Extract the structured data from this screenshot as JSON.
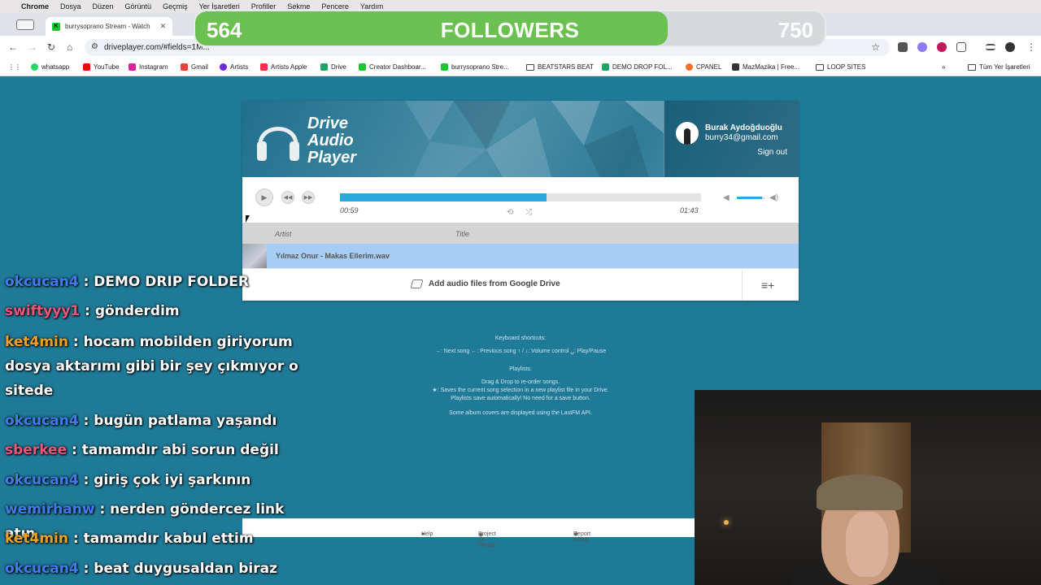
{
  "menubar": {
    "app": "Chrome",
    "items": [
      "Dosya",
      "Düzen",
      "Görüntü",
      "Geçmiş",
      "Yer İşaretleri",
      "Profiller",
      "Sekme",
      "Pencere",
      "Yardım"
    ]
  },
  "tabs": {
    "active_title": "burrysoprano Stream - Watch",
    "partial_title": "le"
  },
  "toolbar": {
    "url": "driveplayer.com/#fields=1M..."
  },
  "bookmarks": [
    {
      "label": "whatsapp",
      "color": "#25d366"
    },
    {
      "label": "YouTube",
      "color": "#ff0000"
    },
    {
      "label": "Instagram",
      "color": "#d6249f"
    },
    {
      "label": "Gmail",
      "color": "#ea4335"
    },
    {
      "label": "Artists",
      "color": "#6d28d9"
    },
    {
      "label": "Artists Apple",
      "color": "#fa2d48"
    },
    {
      "label": "Drive",
      "color": "#1fa463"
    },
    {
      "label": "Creator Dashboar...",
      "color": "#16c72e"
    },
    {
      "label": "burrysoprano Stre...",
      "color": "#16c72e"
    },
    {
      "label": "BEATSTARS BEAT",
      "color": "folder"
    },
    {
      "label": "DEMO DROP FOL...",
      "color": "#1fa463"
    },
    {
      "label": "CPANEL",
      "color": "#ff6c2c"
    },
    {
      "label": "MazMazika | Free...",
      "color": "#333333"
    },
    {
      "label": "LOOP SITES",
      "color": "folder"
    },
    {
      "label": "Tüm Yer İşaretleri",
      "color": "folder"
    }
  ],
  "followers": {
    "current": "564",
    "label": "FOLLOWERS",
    "goal": "750",
    "progress_fraction": 0.75
  },
  "player": {
    "logo_line1": "Drive",
    "logo_line2": "Audio",
    "logo_line3": "Player",
    "user_name": "Burak Aydoğduoğlu",
    "user_email": "burry34@gmail.com",
    "sign_out": "Sign out",
    "elapsed": "00:59",
    "duration": "01:43",
    "progress_fraction": 0.573,
    "volume_fraction": 0.9,
    "col_artist": "Artist",
    "col_title": "Title",
    "song": "Yılmaz Onur - Makas Ellerim.wav",
    "add_label": "Add audio files from Google Drive"
  },
  "help": {
    "kb_title": "Keyboard shortcuts:",
    "kb_text": "→: Next song  ←: Previous song  ↑ / ↓: Volume control  ␣: Play/Pause",
    "pl_title": "Playlists:",
    "pl_line1": "Drag & Drop to re-order songs.",
    "pl_line2": "★: Saves the current song selection in a new playlist file in your Drive.",
    "pl_line3": "Playlists save automatically! No need for a save button.",
    "lastfm": "Some album covers are displayed using the LastFM API."
  },
  "footer": {
    "help": "Help",
    "github": "Project on GitHub",
    "bug": "Report a bug"
  },
  "chat": [
    {
      "user": "okcucan4",
      "color": "#3f7cf0",
      "text": ": DEMO DRIP FOLDER"
    },
    {
      "user": "swiftyyy1",
      "color": "#f2547a",
      "text": ": gönderdim"
    },
    {
      "user": "ket4min",
      "color": "#f0a020",
      "text": ": hocam mobilden giriyorum dosya aktarımı gibi bir şey çıkmıyor o sitede"
    },
    {
      "user": "okcucan4",
      "color": "#3f7cf0",
      "text": ": bugün patlama yaşandı"
    },
    {
      "user": "sberkee",
      "color": "#f2547a",
      "text": ": tamamdır abi sorun değil"
    },
    {
      "user": "okcucan4",
      "color": "#3f7cf0",
      "text": ": giriş çok iyi şarkının"
    },
    {
      "user": "wemirhanw",
      "color": "#3f7cf0",
      "text": ": nerden göndercez link atın"
    },
    {
      "user": "ket4min",
      "color": "#f0a020",
      "text": ": tamamdır kabul ettim"
    },
    {
      "user": "okcucan4",
      "color": "#3f7cf0",
      "text": ": beat duygusaldan biraz uzak"
    }
  ]
}
